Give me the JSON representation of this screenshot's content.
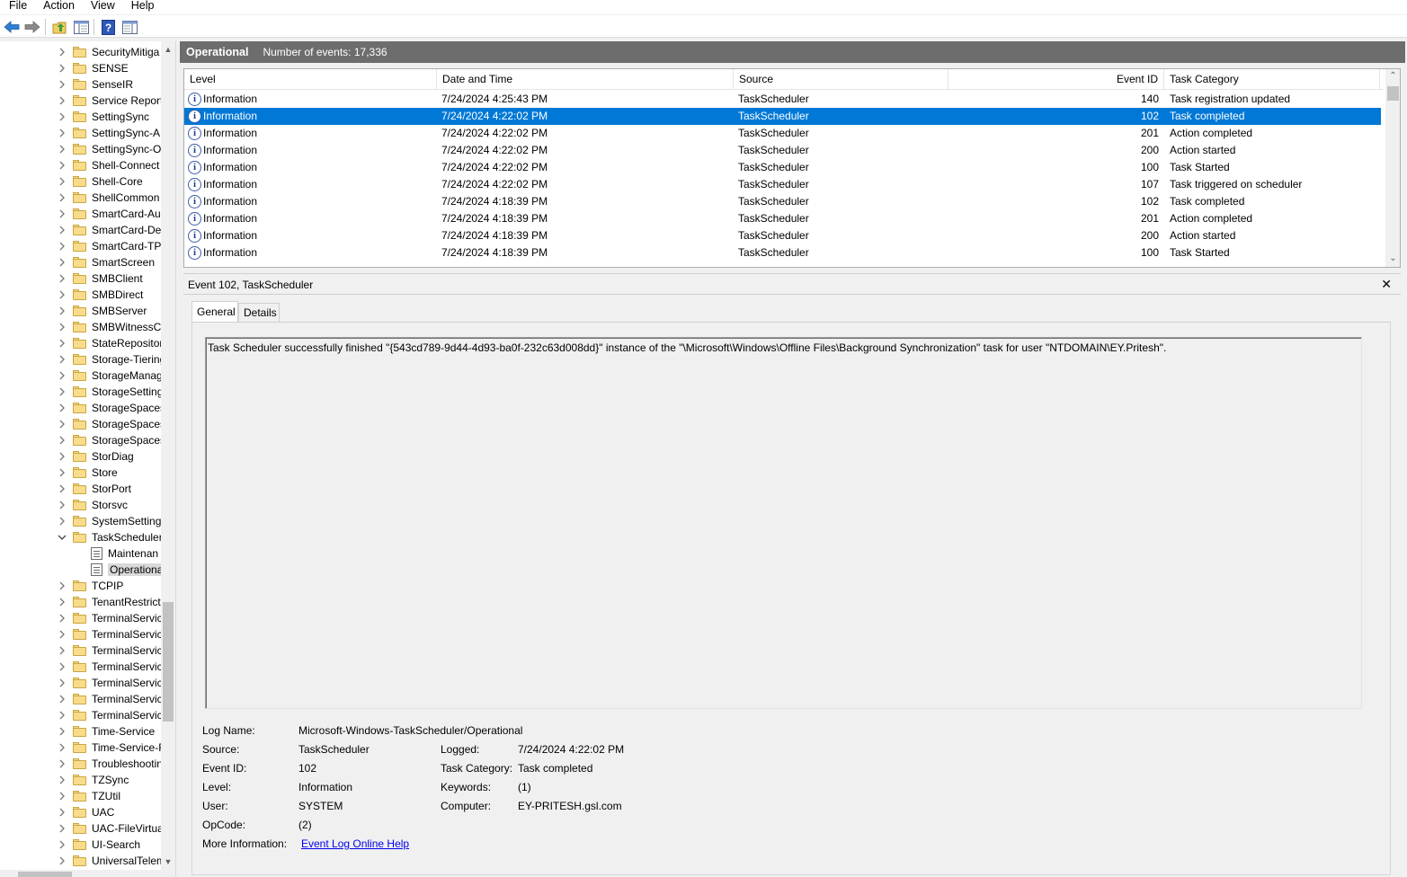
{
  "menu": [
    "File",
    "Action",
    "View",
    "Help"
  ],
  "toolbar": {
    "icons": [
      "back-arrow-icon",
      "forward-arrow-icon",
      "up-folder-icon",
      "show-hide-tree-icon",
      "help-icon",
      "show-hide-action-pane-icon"
    ]
  },
  "tree": {
    "items": [
      {
        "label": "SecurityMitiga",
        "type": "folder",
        "expanded": false
      },
      {
        "label": "SENSE",
        "type": "folder",
        "expanded": false
      },
      {
        "label": "SenseIR",
        "type": "folder",
        "expanded": false
      },
      {
        "label": "Service Report",
        "type": "folder",
        "expanded": false
      },
      {
        "label": "SettingSync",
        "type": "folder",
        "expanded": false
      },
      {
        "label": "SettingSync-A",
        "type": "folder",
        "expanded": false
      },
      {
        "label": "SettingSync-O",
        "type": "folder",
        "expanded": false
      },
      {
        "label": "Shell-Connect",
        "type": "folder",
        "expanded": false
      },
      {
        "label": "Shell-Core",
        "type": "folder",
        "expanded": false
      },
      {
        "label": "ShellCommon",
        "type": "folder",
        "expanded": false
      },
      {
        "label": "SmartCard-Au",
        "type": "folder",
        "expanded": false
      },
      {
        "label": "SmartCard-De",
        "type": "folder",
        "expanded": false
      },
      {
        "label": "SmartCard-TPI",
        "type": "folder",
        "expanded": false
      },
      {
        "label": "SmartScreen",
        "type": "folder",
        "expanded": false
      },
      {
        "label": "SMBClient",
        "type": "folder",
        "expanded": false
      },
      {
        "label": "SMBDirect",
        "type": "folder",
        "expanded": false
      },
      {
        "label": "SMBServer",
        "type": "folder",
        "expanded": false
      },
      {
        "label": "SMBWitnessCl",
        "type": "folder",
        "expanded": false
      },
      {
        "label": "StateRepositor",
        "type": "folder",
        "expanded": false
      },
      {
        "label": "Storage-Tiering",
        "type": "folder",
        "expanded": false
      },
      {
        "label": "StorageManag",
        "type": "folder",
        "expanded": false
      },
      {
        "label": "StorageSetting",
        "type": "folder",
        "expanded": false
      },
      {
        "label": "StorageSpaces",
        "type": "folder",
        "expanded": false
      },
      {
        "label": "StorageSpaces",
        "type": "folder",
        "expanded": false
      },
      {
        "label": "StorageSpaces",
        "type": "folder",
        "expanded": false
      },
      {
        "label": "StorDiag",
        "type": "folder",
        "expanded": false
      },
      {
        "label": "Store",
        "type": "folder",
        "expanded": false
      },
      {
        "label": "StorPort",
        "type": "folder",
        "expanded": false
      },
      {
        "label": "Storsvc",
        "type": "folder",
        "expanded": false
      },
      {
        "label": "SystemSetting",
        "type": "folder",
        "expanded": false
      },
      {
        "label": "TaskScheduler",
        "type": "folder",
        "expanded": true
      },
      {
        "label": "Maintenan",
        "type": "log",
        "child": true
      },
      {
        "label": "Operationa",
        "type": "log",
        "child": true,
        "selected": true
      },
      {
        "label": "TCPIP",
        "type": "folder",
        "expanded": false
      },
      {
        "label": "TenantRestricti",
        "type": "folder",
        "expanded": false
      },
      {
        "label": "TerminalServic",
        "type": "folder",
        "expanded": false
      },
      {
        "label": "TerminalServic",
        "type": "folder",
        "expanded": false
      },
      {
        "label": "TerminalServic",
        "type": "folder",
        "expanded": false
      },
      {
        "label": "TerminalServic",
        "type": "folder",
        "expanded": false
      },
      {
        "label": "TerminalServic",
        "type": "folder",
        "expanded": false
      },
      {
        "label": "TerminalServic",
        "type": "folder",
        "expanded": false
      },
      {
        "label": "TerminalServic",
        "type": "folder",
        "expanded": false
      },
      {
        "label": "Time-Service",
        "type": "folder",
        "expanded": false
      },
      {
        "label": "Time-Service-F",
        "type": "folder",
        "expanded": false
      },
      {
        "label": "Troubleshootin",
        "type": "folder",
        "expanded": false
      },
      {
        "label": "TZSync",
        "type": "folder",
        "expanded": false
      },
      {
        "label": "TZUtil",
        "type": "folder",
        "expanded": false
      },
      {
        "label": "UAC",
        "type": "folder",
        "expanded": false
      },
      {
        "label": "UAC-FileVirtua",
        "type": "folder",
        "expanded": false
      },
      {
        "label": "UI-Search",
        "type": "folder",
        "expanded": false
      },
      {
        "label": "UniversalTelem",
        "type": "folder",
        "expanded": false
      }
    ]
  },
  "header": {
    "title": "Operational",
    "count_text": "Number of events: 17,336"
  },
  "grid": {
    "columns": [
      "Level",
      "Date and Time",
      "Source",
      "Event ID",
      "Task Category"
    ],
    "rows": [
      {
        "level": "Information",
        "datetime": "7/24/2024 4:25:43 PM",
        "source": "TaskScheduler",
        "event_id": "140",
        "category": "Task registration updated",
        "selected": false
      },
      {
        "level": "Information",
        "datetime": "7/24/2024 4:22:02 PM",
        "source": "TaskScheduler",
        "event_id": "102",
        "category": "Task completed",
        "selected": true
      },
      {
        "level": "Information",
        "datetime": "7/24/2024 4:22:02 PM",
        "source": "TaskScheduler",
        "event_id": "201",
        "category": "Action completed",
        "selected": false
      },
      {
        "level": "Information",
        "datetime": "7/24/2024 4:22:02 PM",
        "source": "TaskScheduler",
        "event_id": "200",
        "category": "Action started",
        "selected": false
      },
      {
        "level": "Information",
        "datetime": "7/24/2024 4:22:02 PM",
        "source": "TaskScheduler",
        "event_id": "100",
        "category": "Task Started",
        "selected": false
      },
      {
        "level": "Information",
        "datetime": "7/24/2024 4:22:02 PM",
        "source": "TaskScheduler",
        "event_id": "107",
        "category": "Task triggered on scheduler",
        "selected": false
      },
      {
        "level": "Information",
        "datetime": "7/24/2024 4:18:39 PM",
        "source": "TaskScheduler",
        "event_id": "102",
        "category": "Task completed",
        "selected": false
      },
      {
        "level": "Information",
        "datetime": "7/24/2024 4:18:39 PM",
        "source": "TaskScheduler",
        "event_id": "201",
        "category": "Action completed",
        "selected": false
      },
      {
        "level": "Information",
        "datetime": "7/24/2024 4:18:39 PM",
        "source": "TaskScheduler",
        "event_id": "200",
        "category": "Action started",
        "selected": false
      },
      {
        "level": "Information",
        "datetime": "7/24/2024 4:18:39 PM",
        "source": "TaskScheduler",
        "event_id": "100",
        "category": "Task Started",
        "selected": false
      }
    ]
  },
  "detail": {
    "title": "Event 102, TaskScheduler",
    "close_glyph": "✕",
    "tabs": [
      "General",
      "Details"
    ],
    "message": "Task Scheduler successfully finished \"{543cd789-9d44-4d93-ba0f-232c63d008dd}\" instance of the \"\\Microsoft\\Windows\\Offline Files\\Background Synchronization\" task for user \"NTDOMAIN\\EY.Pritesh\".",
    "props": {
      "log_name_label": "Log Name:",
      "log_name": "Microsoft-Windows-TaskScheduler/Operational",
      "source_label": "Source:",
      "source": "TaskScheduler",
      "logged_label": "Logged:",
      "logged": "7/24/2024 4:22:02 PM",
      "event_id_label": "Event ID:",
      "event_id": "102",
      "task_category_label": "Task Category:",
      "task_category": "Task completed",
      "level_label": "Level:",
      "level": "Information",
      "keywords_label": "Keywords:",
      "keywords": "(1)",
      "user_label": "User:",
      "user": "SYSTEM",
      "computer_label": "Computer:",
      "computer": "EY-PRITESH.gsl.com",
      "opcode_label": "OpCode:",
      "opcode": "(2)",
      "more_info_label": "More Information:",
      "more_info_link": "Event Log Online Help"
    }
  }
}
